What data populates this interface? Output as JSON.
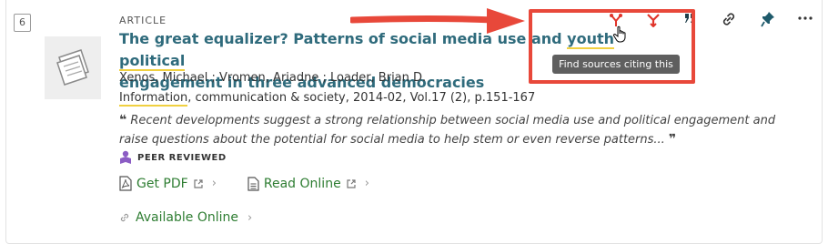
{
  "result": {
    "number": "6",
    "type": "ARTICLE",
    "title_part1": "The great equalizer? Patterns of social media use and ",
    "title_highlight": "youth political",
    "title_part2": "engagement in three advanced democracies",
    "authors": "Xenos, Michael ; Vromen, Ariadne ; Loader, Brian D.",
    "source_highlight": "Information",
    "source_rest": ", communication & society, 2014-02, Vol.17 (2), p.151-167",
    "snippet": "Recent developments suggest a strong relationship between social media use and political engagement and raise questions about the potential for social media to help stem or even reverse patterns...",
    "peer_reviewed": "PEER REVIEWED"
  },
  "links": {
    "get_pdf": "Get PDF",
    "read_online": "Read Online",
    "available_online": "Available Online"
  },
  "tooltip": "Find sources citing this",
  "colors": {
    "title": "#2f6b7c",
    "link": "#2e7d32",
    "citation_icon": "#e0342a",
    "pin_icon": "#1f5a6b",
    "highlight": "#f0d040",
    "annotation": "#e8483a"
  },
  "icons": {
    "citing": "citing-this-icon",
    "cited": "cited-in-this-icon",
    "cite": "citation-quote-icon",
    "link": "permalink-icon",
    "pin": "pin-icon",
    "more": "more-options-icon"
  }
}
